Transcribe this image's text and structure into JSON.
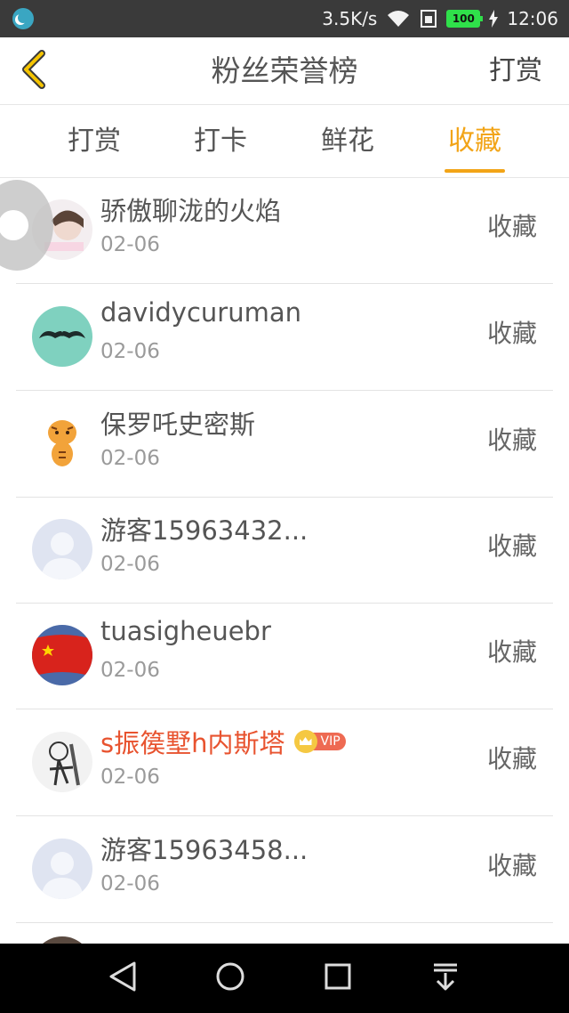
{
  "status_bar": {
    "net_speed": "3.5K/s",
    "battery": "100",
    "time": "12:06"
  },
  "header": {
    "title": "粉丝荣誉榜",
    "action_label": "打赏"
  },
  "tabs": [
    {
      "label": "打赏",
      "active": false
    },
    {
      "label": "打卡",
      "active": false
    },
    {
      "label": "鲜花",
      "active": false
    },
    {
      "label": "收藏",
      "active": true
    }
  ],
  "rows": [
    {
      "name": "骄傲聊泷的火焰",
      "date": "02-06",
      "action": "收藏",
      "avatar": "photo-girl-avatar"
    },
    {
      "name": "davidycuruman",
      "date": "02-06",
      "action": "收藏",
      "avatar": "mustache-avatar"
    },
    {
      "name": "保罗吒史密斯",
      "date": "02-06",
      "action": "收藏",
      "avatar": "tiger-avatar"
    },
    {
      "name": "游客15963432...",
      "date": "02-06",
      "action": "收藏",
      "avatar": "default-user-avatar"
    },
    {
      "name": "tuasigheuebr",
      "date": "02-06",
      "action": "收藏",
      "avatar": "flag-avatar"
    },
    {
      "name": "s振篌墅h内斯塔",
      "date": "02-06",
      "action": "收藏",
      "avatar": "sketch-avatar",
      "vip": "VIP"
    },
    {
      "name": "游客15963458...",
      "date": "02-06",
      "action": "收藏",
      "avatar": "default-user-avatar"
    }
  ],
  "colors": {
    "accent": "#f2a417",
    "vip_name": "#e8532f",
    "status_bar": "#3a3a3a"
  }
}
